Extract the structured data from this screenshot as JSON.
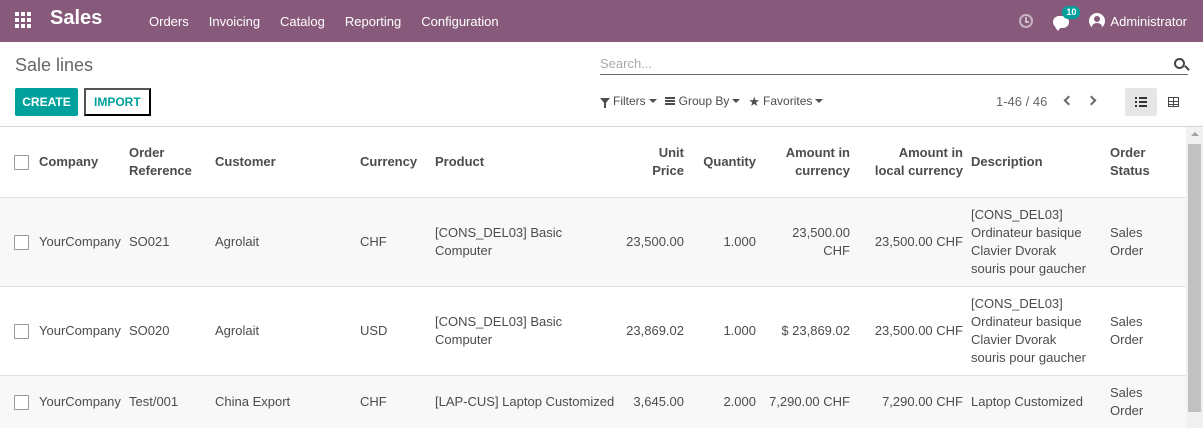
{
  "navbar": {
    "brand": "Sales",
    "menu": [
      "Orders",
      "Invoicing",
      "Catalog",
      "Reporting",
      "Configuration"
    ],
    "messages_count": "10",
    "user": "Administrator"
  },
  "control_panel": {
    "title": "Sale lines",
    "search_placeholder": "Search...",
    "create_label": "CREATE",
    "import_label": "IMPORT",
    "filters_label": "Filters",
    "group_by_label": "Group By",
    "favorites_label": "Favorites",
    "pager": "1-46 / 46"
  },
  "table": {
    "headers": {
      "company": "Company",
      "order_ref_1": "Order",
      "order_ref_2": "Reference",
      "customer": "Customer",
      "currency": "Currency",
      "product": "Product",
      "unit_price_1": "Unit",
      "unit_price_2": "Price",
      "quantity": "Quantity",
      "amount_cur_1": "Amount in",
      "amount_cur_2": "currency",
      "amount_local_1": "Amount in",
      "amount_local_2": "local currency",
      "description": "Description",
      "status_1": "Order",
      "status_2": "Status"
    },
    "rows": [
      {
        "company": "YourCompany",
        "order_ref": "SO021",
        "customer": "Agrolait",
        "currency": "CHF",
        "product": "[CONS_DEL03] Basic Computer",
        "unit_price": "23,500.00",
        "quantity": "1.000",
        "amount_currency": "23,500.00 CHF",
        "amount_local": "23,500.00 CHF",
        "desc_1": "[CONS_DEL03]",
        "desc_2": "Ordinateur basique",
        "desc_3": "Clavier Dvorak",
        "desc_4": "souris pour gaucher",
        "status_1": "Sales",
        "status_2": "Order"
      },
      {
        "company": "YourCompany",
        "order_ref": "SO020",
        "customer": "Agrolait",
        "currency": "USD",
        "product": "[CONS_DEL03] Basic Computer",
        "unit_price": "23,869.02",
        "quantity": "1.000",
        "amount_currency": "$ 23,869.02",
        "amount_local": "23,500.00 CHF",
        "desc_1": "[CONS_DEL03]",
        "desc_2": "Ordinateur basique",
        "desc_3": "Clavier Dvorak",
        "desc_4": "souris pour gaucher",
        "status_1": "Sales",
        "status_2": "Order"
      },
      {
        "company": "YourCompany",
        "order_ref": "Test/001",
        "customer": "China Export",
        "currency": "CHF",
        "product": "[LAP-CUS] Laptop Customized",
        "unit_price": "3,645.00",
        "quantity": "2.000",
        "amount_currency": "7,290.00 CHF",
        "amount_local": "7,290.00 CHF",
        "desc_1": "Laptop Customized",
        "status_1": "Sales",
        "status_2": "Order"
      }
    ]
  },
  "colors": {
    "navbar": "#875a7b",
    "primary": "#00a09d"
  }
}
